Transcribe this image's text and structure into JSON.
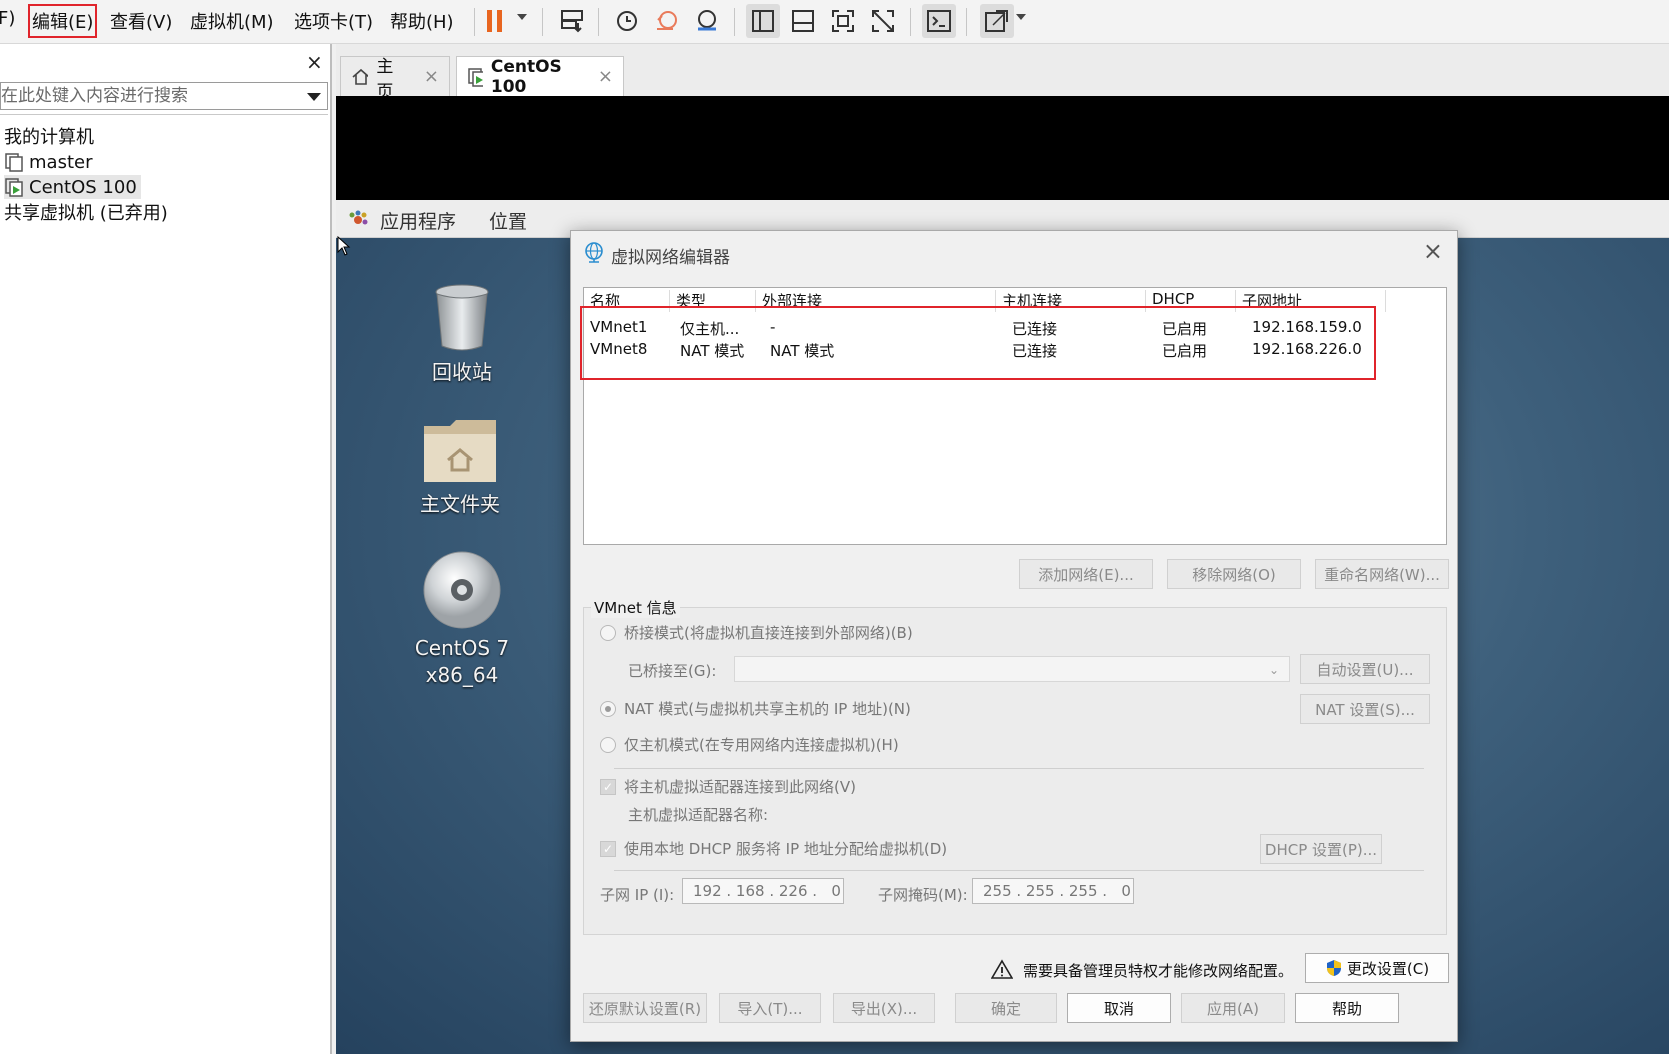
{
  "menubar": {
    "items": [
      "F)",
      "编辑(E)",
      "查看(V)",
      "虚拟机(M)",
      "选项卡(T)",
      "帮助(H)"
    ]
  },
  "sidebar": {
    "close": "×",
    "search_placeholder": "在此处键入内容进行搜索",
    "tree": [
      "我的计算机",
      "master",
      "CentOS 100",
      "共享虚拟机 (已弃用)"
    ]
  },
  "tabs": [
    {
      "label": "主页",
      "close": "×"
    },
    {
      "label": "CentOS 100",
      "close": "×"
    }
  ],
  "gnome": {
    "applications": "应用程序",
    "places": "位置"
  },
  "desktop": {
    "icons": [
      {
        "label": "回收站"
      },
      {
        "label": "主文件夹"
      },
      {
        "label_line1": "CentOS 7",
        "label_line2": "x86_64"
      }
    ]
  },
  "dialog": {
    "title": "虚拟网络编辑器",
    "close": "×",
    "columns": [
      "名称",
      "类型",
      "外部连接",
      "主机连接",
      "DHCP",
      "子网地址"
    ],
    "rows": [
      [
        "VMnet1",
        "仅主机...",
        "-",
        "已连接",
        "已启用",
        "192.168.159.0"
      ],
      [
        "VMnet8",
        "NAT 模式",
        "NAT 模式",
        "已连接",
        "已启用",
        "192.168.226.0"
      ]
    ],
    "buttons": {
      "add_network": "添加网络(E)...",
      "remove_network": "移除网络(O)",
      "rename_network": "重命名网络(W)..."
    },
    "info": {
      "title": "VMnet 信息",
      "bridged": "桥接模式(将虚拟机直接连接到外部网络)(B)",
      "bridged_to": "已桥接至(G):",
      "auto_settings": "自动设置(U)...",
      "nat": "NAT 模式(与虚拟机共享主机的 IP 地址)(N)",
      "nat_settings": "NAT 设置(S)...",
      "host_only": "仅主机模式(在专用网络内连接虚拟机)(H)",
      "connect_adapter": "将主机虚拟适配器连接到此网络(V)",
      "adapter_name": "主机虚拟适配器名称:",
      "use_dhcp": "使用本地 DHCP 服务将 IP 地址分配给虚拟机(D)",
      "dhcp_settings": "DHCP 设置(P)...",
      "subnet_ip_label": "子网 IP (I):",
      "subnet_ip": "192 . 168 . 226 .   0",
      "subnet_mask_label": "子网掩码(M):",
      "subnet_mask": "255 . 255 . 255 .   0"
    },
    "admin_notice": "需要具备管理员特权才能修改网络配置。",
    "change_settings": "更改设置(C)",
    "footer": {
      "restore_defaults": "还原默认设置(R)",
      "import": "导入(T)...",
      "export": "导出(X)...",
      "ok": "确定",
      "cancel": "取消",
      "apply": "应用(A)",
      "help": "帮助"
    }
  },
  "colors": {
    "highlight": "#e0242b",
    "pause": "#e8651f",
    "shield_blue": "#1f63c6",
    "shield_yellow": "#f2c21b"
  }
}
